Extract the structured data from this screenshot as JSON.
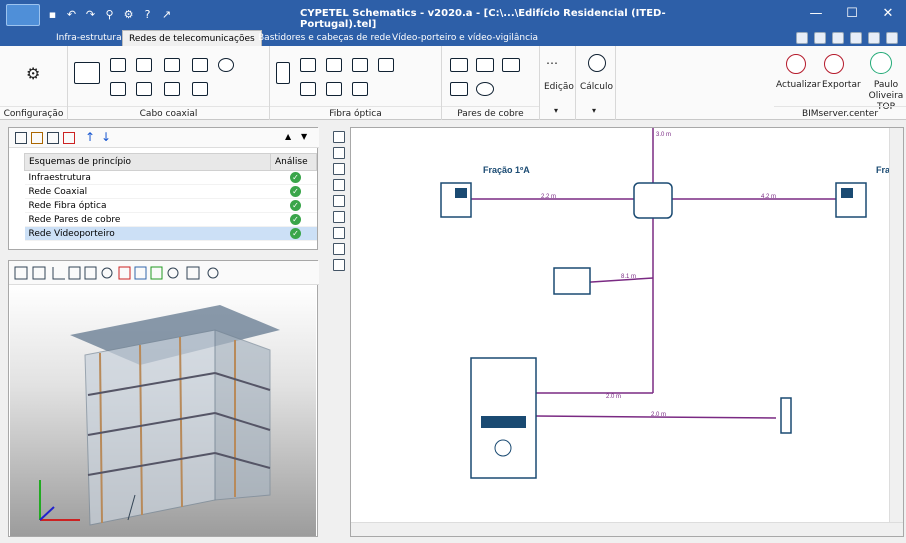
{
  "window": {
    "title": "CYPETEL Schematics - v2020.a - [C:\\...\\Edifício Residencial (ITED-Portugal).tel]",
    "minimize": "—",
    "maximize": "☐",
    "close": "✕"
  },
  "tabs": [
    {
      "label": "Infra-estrutura"
    },
    {
      "label": "Redes de telecomunicações"
    },
    {
      "label": "Bastidores e cabeças de rede"
    },
    {
      "label": "Vídeo-porteiro e vídeo-vigilância"
    }
  ],
  "ribbon": {
    "groups": [
      {
        "label": "Configuração"
      },
      {
        "label": "Cabo coaxial"
      },
      {
        "label": "Fibra óptica"
      },
      {
        "label": "Pares de cobre"
      }
    ],
    "edicao": "Edição",
    "calculo": "Cálculo",
    "actualizar": "Actualizar",
    "exportar": "Exportar",
    "user": "Paulo Oliveira TOP",
    "bimserver": "BIMserver.center"
  },
  "schemes_panel": {
    "header_name": "Esquemas de princípio",
    "header_analysis": "Análise",
    "rows": [
      {
        "name": "Infraestrutura"
      },
      {
        "name": "Rede Coaxial"
      },
      {
        "name": "Rede Fibra óptica"
      },
      {
        "name": "Rede Pares de cobre"
      },
      {
        "name": "Rede Videoporteiro"
      }
    ]
  },
  "diagram": {
    "fraction_left": "Fração 1ºA",
    "fraction_right": "Fraç",
    "lengths": {
      "top": "3.0 m",
      "left": "2.2 m",
      "right": "4.2 m",
      "mid": "8.1 m",
      "bottom1": "2.0 m",
      "bottom2": "2.0 m"
    }
  },
  "colors": {
    "titlebar": "#2d5fa8",
    "wire": "#7a2a83",
    "device": "#1a4a72"
  }
}
